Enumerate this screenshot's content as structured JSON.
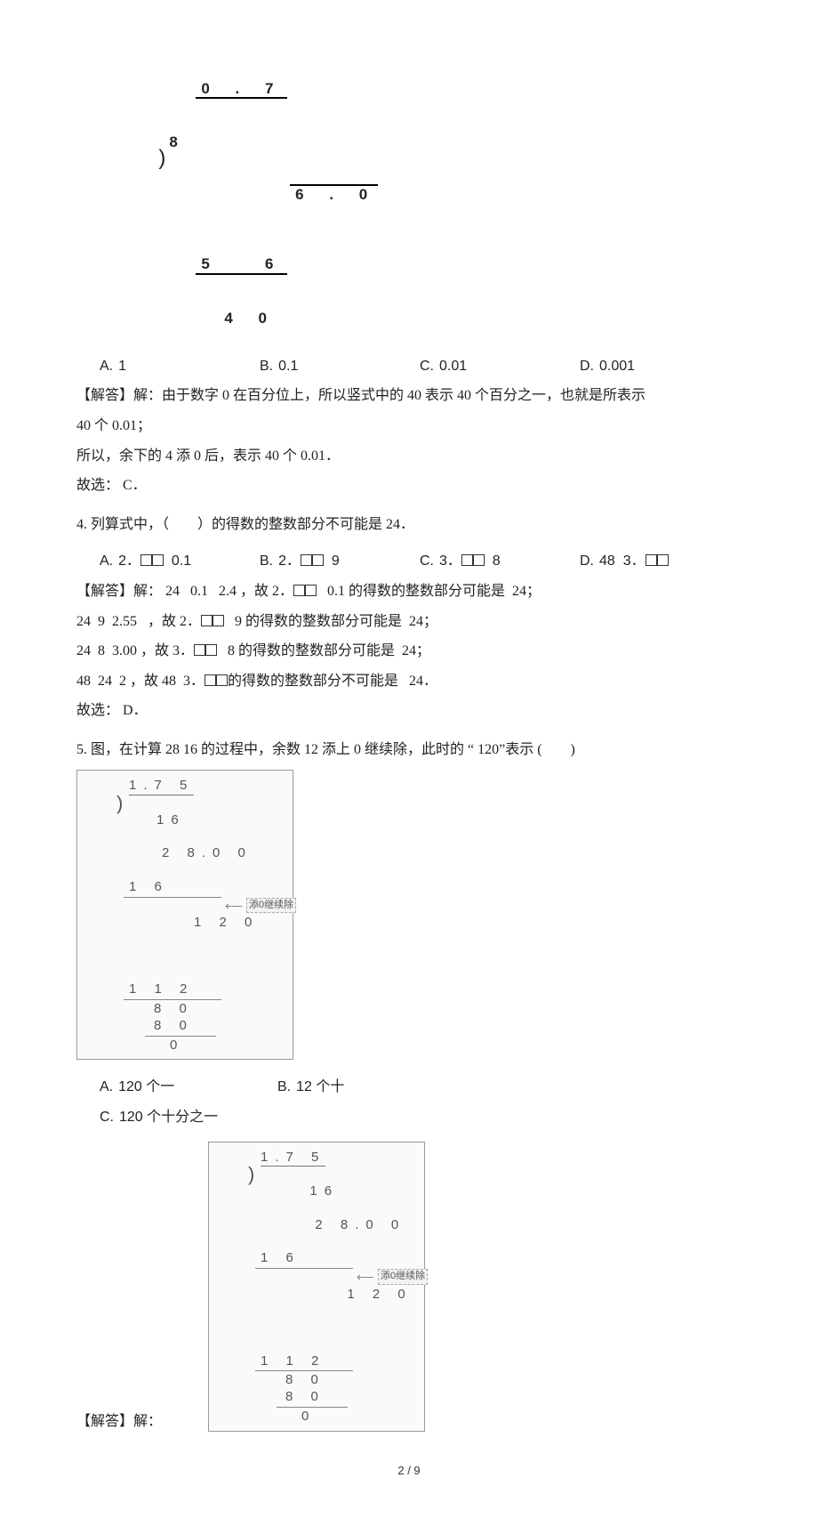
{
  "q3": {
    "longdiv": {
      "quotient": "0 . 7",
      "divisor": "8",
      "dividend": "6 . 0",
      "sub1": "5   6",
      "rem1": "4 0"
    },
    "options": {
      "A": "1",
      "B": "0.1",
      "C": "0.01",
      "D": "0.001"
    },
    "exp1": "【解答】解：由于数字 0 在百分位上，所以竖式中的   40 表示 40 个百分之一，也就是所表示",
    "exp2": "40 个 0.01；",
    "exp3": "所以，余下的  4 添 0 后，表示 40 个 0.01．",
    "exp4": "故选：  C．"
  },
  "q4": {
    "stem": "4. 列算式中，（　　）的得数的整数部分不可能是   24．",
    "options": {
      "A": "2．□□   0.1",
      "B": "2．□□   9",
      "C": "3．□□   8",
      "D": "48   3．□□"
    },
    "exp1": "【解答】解：  24   0.1   2.4 ，故 2．□□    0.1 的得数的整数部分可能是   24；",
    "exp2": "24   9   2.55    ，故 2．□□    9 的得数的整数部分可能是   24；",
    "exp3": "24   8   3.00 ，故 3．□□    8 的得数的整数部分可能是   24；",
    "exp4": "48   24   2 ，故 48   3．□□的得数的整数部分不可能是    24．",
    "exp5": "故选：  D．"
  },
  "q5": {
    "stem": "5. 图，在计算 28  16 的过程中，余数 12 添上 0 继续除，此时的 “ 120”表示 (　　)",
    "longdiv": {
      "quotient": "1.7 5",
      "divisor": "16",
      "dividend": "2 8.0 0",
      "s1": "1 6",
      "r1": "1 2 0",
      "s2": "1 1 2",
      "r2": "8 0",
      "s3": "8 0",
      "r3": "0",
      "note": "添0继续除"
    },
    "options": {
      "A": "120 个一",
      "B": "12 个十",
      "C": "120 个十分之一"
    },
    "expLead": "【解答】解："
  },
  "footer": {
    "page": "2",
    "total": "9",
    "sep": " / "
  }
}
